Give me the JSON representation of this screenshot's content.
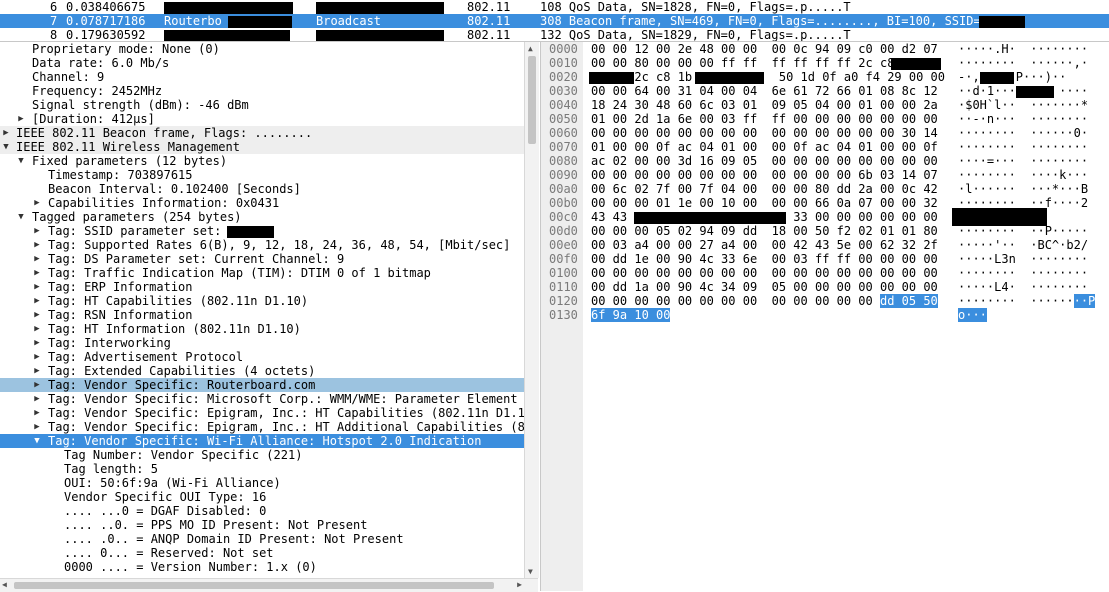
{
  "packet_list": {
    "rows": [
      {
        "no": "6",
        "time": "0.038406675",
        "src": "",
        "dst": "",
        "proto": "802.11",
        "info": "108 QoS Data, SN=1828, FN=0, Flags=.p.....T"
      },
      {
        "no": "7",
        "time": "0.078717186",
        "src": "Routerbo",
        "dst": "Broadcast",
        "proto": "802.11",
        "info": "308 Beacon frame, SN=469, FN=0, Flags=........, BI=100, SSID="
      },
      {
        "no": "8",
        "time": "0.179630592",
        "src": "",
        "dst": "",
        "proto": "802.11",
        "info": "132 QoS Data, SN=1829, FN=0, Flags=.p.....T"
      }
    ]
  },
  "details": {
    "rows": [
      {
        "text": "Proprietary mode: None (0)"
      },
      {
        "text": "Data rate: 6.0 Mb/s"
      },
      {
        "text": "Channel: 9"
      },
      {
        "text": "Frequency: 2452MHz"
      },
      {
        "text": "Signal strength (dBm): -46 dBm"
      },
      {
        "text": "[Duration: 412µs]"
      },
      {
        "text": "IEEE 802.11 Beacon frame, Flags: ........"
      },
      {
        "text": "IEEE 802.11 Wireless Management"
      },
      {
        "text": "Fixed parameters (12 bytes)"
      },
      {
        "text": "Timestamp: 703897615"
      },
      {
        "text": "Beacon Interval: 0.102400 [Seconds]"
      },
      {
        "text": "Capabilities Information: 0x0431"
      },
      {
        "text": "Tagged parameters (254 bytes)"
      },
      {
        "text": "Tag: SSID parameter set: "
      },
      {
        "text": "Tag: Supported Rates 6(B), 9, 12, 18, 24, 36, 48, 54, [Mbit/sec]"
      },
      {
        "text": "Tag: DS Parameter set: Current Channel: 9"
      },
      {
        "text": "Tag: Traffic Indication Map (TIM): DTIM 0 of 1 bitmap"
      },
      {
        "text": "Tag: ERP Information"
      },
      {
        "text": "Tag: HT Capabilities (802.11n D1.10)"
      },
      {
        "text": "Tag: RSN Information"
      },
      {
        "text": "Tag: HT Information (802.11n D1.10)"
      },
      {
        "text": "Tag: Interworking"
      },
      {
        "text": "Tag: Advertisement Protocol"
      },
      {
        "text": "Tag: Extended Capabilities (4 octets)"
      },
      {
        "text": "Tag: Vendor Specific: Routerboard.com"
      },
      {
        "text": "Tag: Vendor Specific: Microsoft Corp.: WMM/WME: Parameter Element"
      },
      {
        "text": "Tag: Vendor Specific: Epigram, Inc.: HT Capabilities (802.11n D1.10)"
      },
      {
        "text": "Tag: Vendor Specific: Epigram, Inc.: HT Additional Capabilities (802.11n D1.00)"
      },
      {
        "text": "Tag: Vendor Specific: Wi-Fi Alliance: Hotspot 2.0 Indication"
      },
      {
        "text": "Tag Number: Vendor Specific (221)"
      },
      {
        "text": "Tag length: 5"
      },
      {
        "text": "OUI: 50:6f:9a (Wi-Fi Alliance)"
      },
      {
        "text": "Vendor Specific OUI Type: 16"
      },
      {
        "text": ".... ...0 = DGAF Disabled: 0"
      },
      {
        "text": ".... ..0. = PPS MO ID Present: Not Present"
      },
      {
        "text": ".... .0.. = ANQP Domain ID Present: Not Present"
      },
      {
        "text": ".... 0... = Reserved: Not set"
      },
      {
        "text": "0000 .... = Version Number: 1.x (0)"
      }
    ]
  },
  "hex": {
    "rows": [
      {
        "off": "0000",
        "hex": "00 00 12 00 2e 48 00 00  00 0c 94 09 c0 00 d2 07",
        "ascii": "·····.H·  ········"
      },
      {
        "off": "0010",
        "hex": "00 00 80 00 00 00 ff ff  ff ff ff ff 2c c8",
        "ascii": "········  ······,·"
      },
      {
        "off": "0020",
        "hex": "      2c c8 1b            50 1d 0f a0 f4 29 00 00",
        "ascii": "-·,     P···)··"
      },
      {
        "off": "0030",
        "hex": "00 00 64 00 31 04 00 04  6e 61 72 66 01 08 8c 12",
        "ascii": "··d·1···      ····"
      },
      {
        "off": "0040",
        "hex": "18 24 30 48 60 6c 03 01  09 05 04 00 01 00 00 2a",
        "ascii": "·$0H`l··  ·······*"
      },
      {
        "off": "0050",
        "hex": "01 00 2d 1a 6e 00 03 ff  ff 00 00 00 00 00 00 00",
        "ascii": "··-·n···  ········"
      },
      {
        "off": "0060",
        "hex": "00 00 00 00 00 00 00 00  00 00 00 00 00 00 30 14",
        "ascii": "········  ······0·"
      },
      {
        "off": "0070",
        "hex": "01 00 00 0f ac 04 01 00  00 0f ac 04 01 00 00 0f",
        "ascii": "········  ········"
      },
      {
        "off": "0080",
        "hex": "ac 02 00 00 3d 16 09 05  00 00 00 00 00 00 00 00",
        "ascii": "····=···  ········"
      },
      {
        "off": "0090",
        "hex": "00 00 00 00 00 00 00 00  00 00 00 00 6b 03 14 07",
        "ascii": "········  ····k···"
      },
      {
        "off": "00a0",
        "hex": "00 6c 02 7f 00 7f 04 00  00 00 80 dd 2a 00 0c 42",
        "ascii": "·l······  ···*···B"
      },
      {
        "off": "00b0",
        "hex": "00 00 00 01 1e 00 10 00  00 00 66 0a 07 00 00 32",
        "ascii": "········  ··f····2"
      },
      {
        "off": "00c0",
        "hex": "43 43                    39 33 00 00 00 00 00 00",
        "ascii": ""
      },
      {
        "off": "00d0",
        "hex": "00 00 00 05 02 94 09 dd  18 00 50 f2 02 01 01 80",
        "ascii": "········  ··P·····"
      },
      {
        "off": "00e0",
        "hex": "00 03 a4 00 00 27 a4 00  00 42 43 5e 00 62 32 2f",
        "ascii": "·····'··  ·BC^·b2/"
      },
      {
        "off": "00f0",
        "hex": "00 dd 1e 00 90 4c 33 6e  00 03 ff ff 00 00 00 00",
        "ascii": "·····L3n  ········"
      },
      {
        "off": "0100",
        "hex": "00 00 00 00 00 00 00 00  00 00 00 00 00 00 00 00",
        "ascii": "········  ········"
      },
      {
        "off": "0110",
        "hex": "00 dd 1a 00 90 4c 34 09  05 00 00 00 00 00 00 00",
        "ascii": "·····L4·  ········"
      },
      {
        "off": "0120",
        "hex": "00 00 00 00 00 00 00 00  00 00 00 00 00 ",
        "hex_sel": "dd 05 50",
        "ascii": "········  ······",
        "ascii_sel": "··P"
      },
      {
        "off": "0130",
        "hex": "",
        "hex_sel": "6f 9a 10 00",
        "ascii": "",
        "ascii_sel": "o···"
      }
    ]
  },
  "colors": {
    "selected": "#3b8ede",
    "highlight": "#9cc3e0",
    "header": "#eeeeee",
    "offsets_bg": "#eeeeee"
  }
}
